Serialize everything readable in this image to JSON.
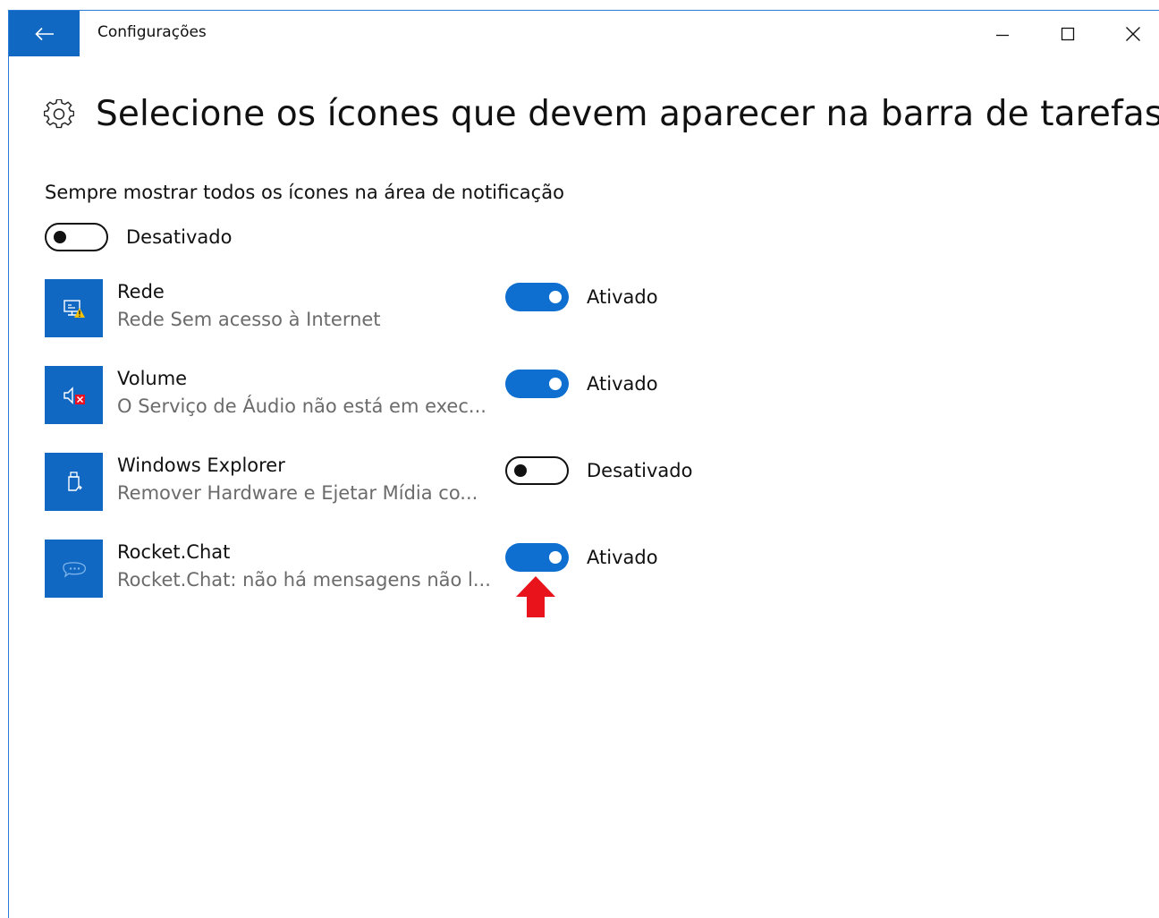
{
  "window": {
    "title": "Configurações",
    "back_icon": "back-arrow-icon",
    "controls": [
      "minimize-icon",
      "maximize-icon",
      "close-icon"
    ],
    "accent_color": "#1168c3"
  },
  "page": {
    "icon": "gear-icon",
    "title": "Selecione os ícones que devem aparecer na barra de tarefas"
  },
  "master": {
    "label": "Sempre mostrar todos os ícones na área de notificação",
    "state": "off",
    "state_label": "Desativado"
  },
  "items": [
    {
      "name": "Rede",
      "description": "Rede Sem acesso à Internet",
      "icon": "network-warning-icon",
      "state": "on",
      "state_label": "Ativado"
    },
    {
      "name": "Volume",
      "description": "O Serviço de Áudio não está em exec...",
      "icon": "volume-muted-icon",
      "state": "on",
      "state_label": "Ativado"
    },
    {
      "name": "Windows Explorer",
      "description": "Remover Hardware e Ejetar Mídia co...",
      "icon": "usb-eject-icon",
      "state": "off",
      "state_label": "Desativado"
    },
    {
      "name": "Rocket.Chat",
      "description": "Rocket.Chat: não há mensagens não l...",
      "icon": "rocket-chat-icon",
      "state": "on",
      "state_label": "Ativado"
    }
  ],
  "annotation": {
    "icon": "red-up-arrow-icon",
    "color": "#e8131b"
  }
}
